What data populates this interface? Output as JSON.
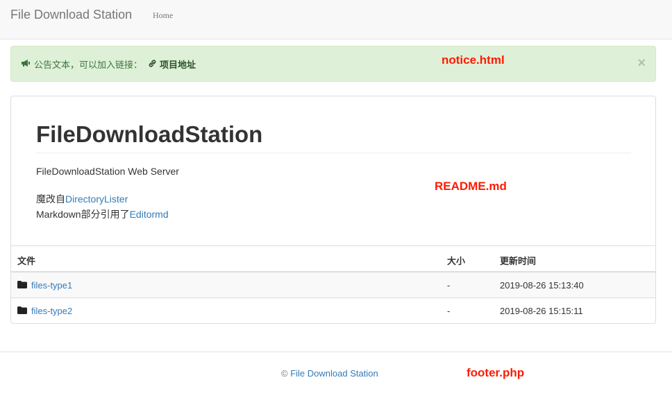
{
  "navbar": {
    "brand": "File Download Station",
    "home": "Home"
  },
  "notice": {
    "text": "公告文本，可以加入链接：",
    "link_label": "项目地址",
    "close": "×"
  },
  "annotations": {
    "notice": "notice.html",
    "readme": "README.md",
    "footer": "footer.php"
  },
  "readme": {
    "title": "FileDownloadStation",
    "line1": "FileDownloadStation Web Server",
    "line2_prefix": "魔改自",
    "line2_link": "DirectoryLister",
    "line3_prefix": "Markdown部分引用了",
    "line3_link": "Editormd"
  },
  "table": {
    "headers": {
      "name": "文件",
      "size": "大小",
      "time": "更新时间"
    },
    "rows": [
      {
        "name": "files-type1",
        "size": "-",
        "time": "2019-08-26 15:13:40",
        "icon": "folder-icon"
      },
      {
        "name": "files-type2",
        "size": "-",
        "time": "2019-08-26 15:15:11",
        "icon": "folder-icon"
      }
    ]
  },
  "footer": {
    "copyright": "©",
    "link": "File Download Station"
  },
  "colors": {
    "link": "#337ab7",
    "alert_bg": "#dff0d8",
    "annotation": "#ff1a00"
  }
}
